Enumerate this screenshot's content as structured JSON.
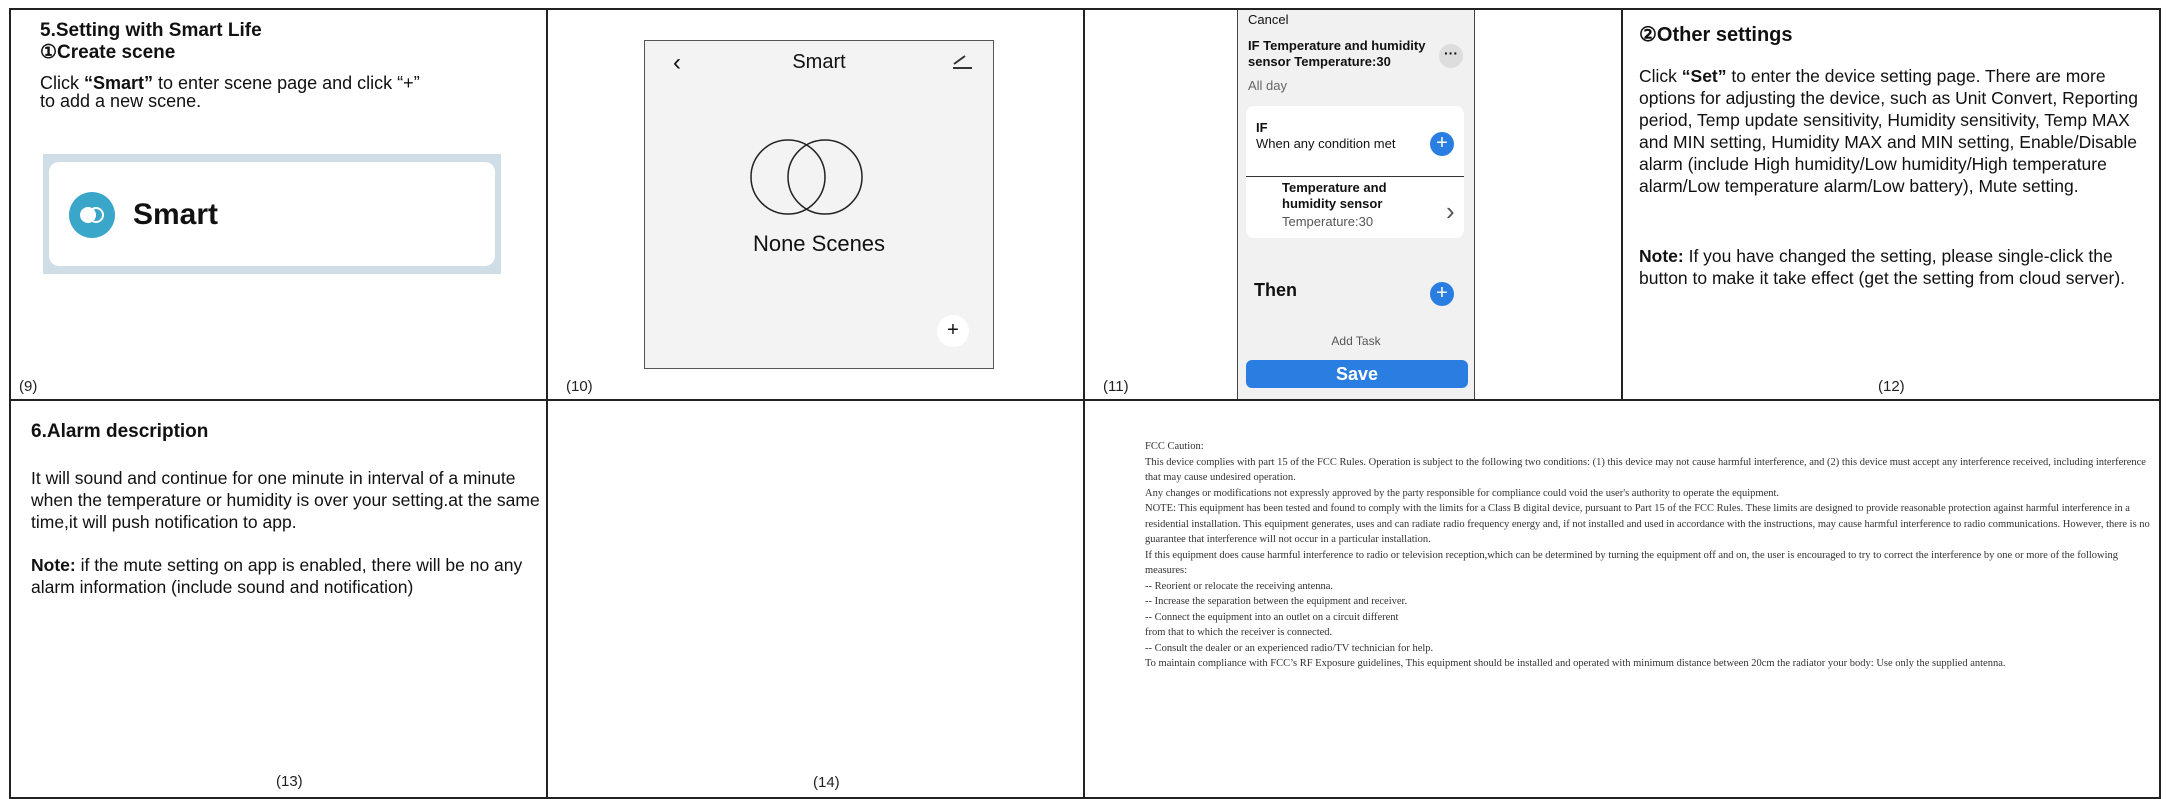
{
  "cell9": {
    "heading_line1": "5.Setting with Smart Life",
    "heading_line2": "①Create scene",
    "text_pre": "Click ",
    "text_bold": "“Smart”",
    "text_post": " to enter scene page and click “+”",
    "text_line2": "to add a new scene.",
    "button_label": "Smart",
    "page_number": "(9)"
  },
  "cell10": {
    "title": "Smart",
    "empty_text": "None Scenes",
    "fab": "+",
    "page_number": "(10)"
  },
  "cell11": {
    "cancel": "Cancel",
    "if_title": "IF Temperature and humidity sensor Temperature:30",
    "dots": "···",
    "all_day": "All day",
    "if_label": "IF",
    "when": "When any condition met",
    "condition_name": "Temperature and humidity sensor",
    "condition_value": "Temperature:30",
    "then": "Then",
    "add_task": "Add Task",
    "save": "Save",
    "page_number": "(11)"
  },
  "cell12": {
    "heading": "②Other settings",
    "text_pre": "Click ",
    "text_bold": "“Set”",
    "text_post": " to enter the device setting page. There are more options for adjusting the device, such as Unit Convert, Reporting period, Temp update sensitivity, Humidity sensitivity, Temp MAX and MIN setting, Humidity MAX and MIN setting, Enable/Disable alarm (include High humidity/Low humidity/High temperature alarm/Low temperature alarm/Low battery), Mute setting.",
    "note_label": "Note:",
    "note_text": " If you have changed the setting, please single-click the button to make it take effect (get the setting from cloud server).",
    "page_number": "(12)"
  },
  "cell13": {
    "heading": "6.Alarm description",
    "text": "It will sound and continue for one minute in interval of a minute when the temperature or humidity is over your setting.at the same time,it will push notification to app.",
    "note_label": "Note:",
    "note_text": " if the mute setting on app is enabled, there will be no any alarm information (include sound and notification)",
    "page_number": "(13)"
  },
  "cell14": {
    "page_number": "(14)"
  },
  "fcc": {
    "lines": [
      "FCC Caution:",
      "This device complies with part 15 of the FCC Rules. Operation is subject to the following two conditions: (1) this device may not cause harmful interference, and (2) this device must accept any interference received, including interference that may cause undesired operation.",
      "Any changes or modifications not expressly approved by the party responsible for compliance could void the user's authority to operate the equipment.",
      "NOTE: This equipment has been tested and found to comply with the limits for a Class B digital device, pursuant to Part 15 of the FCC Rules. These limits are designed to provide reasonable protection against harmful interference in a residential installation. This equipment generates, uses and can radiate radio frequency energy and, if not installed and used in accordance with the instructions, may cause harmful interference to radio communications. However, there is no guarantee that interference will not occur in a particular installation.",
      "If this equipment does cause harmful interference to radio or television reception,which can be determined by turning the equipment off and on, the user is encouraged to try to correct the interference by one or more of the following measures:",
      "-- Reorient or relocate the receiving antenna.",
      "-- Increase the separation between the equipment and receiver.",
      "-- Connect the equipment into an outlet on a circuit different",
      "from that to which the receiver is connected.",
      "-- Consult the dealer or an experienced radio/TV technician for help.",
      "To maintain compliance with FCC’s RF Exposure guidelines, This equipment should be installed and operated with minimum distance between 20cm the radiator your body: Use only the supplied antenna."
    ]
  },
  "colors": {
    "accent_blue": "#2a7de1",
    "smart_icon": "#3aa6c9"
  }
}
